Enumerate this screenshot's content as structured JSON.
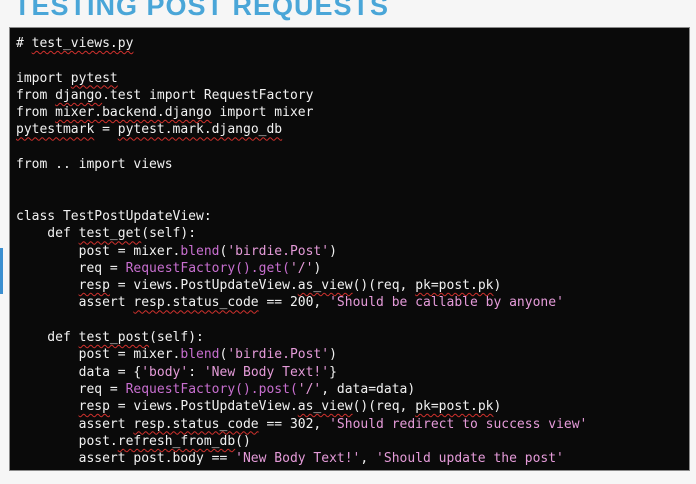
{
  "slide": {
    "title": "TESTING POST REQUESTS"
  },
  "colors": {
    "title": "#4aa6d8",
    "panel_bg": "#0a0a0a",
    "code_text": "#f2f2f2",
    "string": "#e59bd9",
    "call": "#c86fd0",
    "spell_squiggle": "#d0312d"
  },
  "code": {
    "lines": [
      [
        {
          "t": "# "
        },
        {
          "t": "test_views.py",
          "c": "sq"
        }
      ],
      [
        {
          "t": ""
        }
      ],
      [
        {
          "t": "import "
        },
        {
          "t": "pytest",
          "c": "sq"
        }
      ],
      [
        {
          "t": "from "
        },
        {
          "t": "django",
          "c": "sq"
        },
        {
          "t": ".test import RequestFactory"
        }
      ],
      [
        {
          "t": "from "
        },
        {
          "t": "mixer.backend.django",
          "c": "sq"
        },
        {
          "t": " import mixer"
        }
      ],
      [
        {
          "t": "pytestmark",
          "c": "sq"
        },
        {
          "t": " = "
        },
        {
          "t": "pytest.mark.django_db",
          "c": "sq"
        }
      ],
      [
        {
          "t": ""
        }
      ],
      [
        {
          "t": "from .. import views"
        }
      ],
      [
        {
          "t": ""
        }
      ],
      [
        {
          "t": ""
        }
      ],
      [
        {
          "t": "class TestPostUpdateView:"
        }
      ],
      [
        {
          "t": "    def "
        },
        {
          "t": "test_get",
          "c": "sq"
        },
        {
          "t": "(self):"
        }
      ],
      [
        {
          "t": "        post = mixer."
        },
        {
          "t": "blend",
          "c": "call"
        },
        {
          "t": "("
        },
        {
          "t": "'birdie.Post'",
          "c": "str"
        },
        {
          "t": ")"
        }
      ],
      [
        {
          "t": "        req = "
        },
        {
          "t": "RequestFactory().get(",
          "c": "call"
        },
        {
          "t": "'/'",
          "c": "str"
        },
        {
          "t": ")"
        }
      ],
      [
        {
          "t": "        "
        },
        {
          "t": "resp",
          "c": "sq"
        },
        {
          "t": " = views.PostUpdateView."
        },
        {
          "t": "as_view",
          "c": "sq"
        },
        {
          "t": "()(req, "
        },
        {
          "t": "pk=post.pk",
          "c": "sq"
        },
        {
          "t": ")"
        }
      ],
      [
        {
          "t": "        assert "
        },
        {
          "t": "resp.status_code",
          "c": "sq"
        },
        {
          "t": " == 200, "
        },
        {
          "t": "'Should be callable by anyone'",
          "c": "str"
        }
      ],
      [
        {
          "t": ""
        }
      ],
      [
        {
          "t": "    def "
        },
        {
          "t": "test_post",
          "c": "sq"
        },
        {
          "t": "(self):"
        }
      ],
      [
        {
          "t": "        post = mixer."
        },
        {
          "t": "blend",
          "c": "call"
        },
        {
          "t": "("
        },
        {
          "t": "'birdie.Post'",
          "c": "str"
        },
        {
          "t": ")"
        }
      ],
      [
        {
          "t": "        data = {"
        },
        {
          "t": "'body'",
          "c": "str"
        },
        {
          "t": ": "
        },
        {
          "t": "'New Body Text!'",
          "c": "str"
        },
        {
          "t": "}"
        }
      ],
      [
        {
          "t": "        req = "
        },
        {
          "t": "RequestFactory().post(",
          "c": "call"
        },
        {
          "t": "'/'",
          "c": "str"
        },
        {
          "t": ", data=data)"
        }
      ],
      [
        {
          "t": "        "
        },
        {
          "t": "resp",
          "c": "sq"
        },
        {
          "t": " = views.PostUpdateView."
        },
        {
          "t": "as_view",
          "c": "sq"
        },
        {
          "t": "()(req, "
        },
        {
          "t": "pk=post.pk",
          "c": "sq"
        },
        {
          "t": ")"
        }
      ],
      [
        {
          "t": "        assert "
        },
        {
          "t": "resp.status_code",
          "c": "sq"
        },
        {
          "t": " == 302, "
        },
        {
          "t": "'Should redirect to success view'",
          "c": "str"
        }
      ],
      [
        {
          "t": "        post."
        },
        {
          "t": "refresh_from_db",
          "c": "sq"
        },
        {
          "t": "()"
        }
      ],
      [
        {
          "t": "        assert post.body == "
        },
        {
          "t": "'New Body Text!'",
          "c": "str"
        },
        {
          "t": ", "
        },
        {
          "t": "'Should update the post'",
          "c": "str"
        }
      ]
    ]
  }
}
